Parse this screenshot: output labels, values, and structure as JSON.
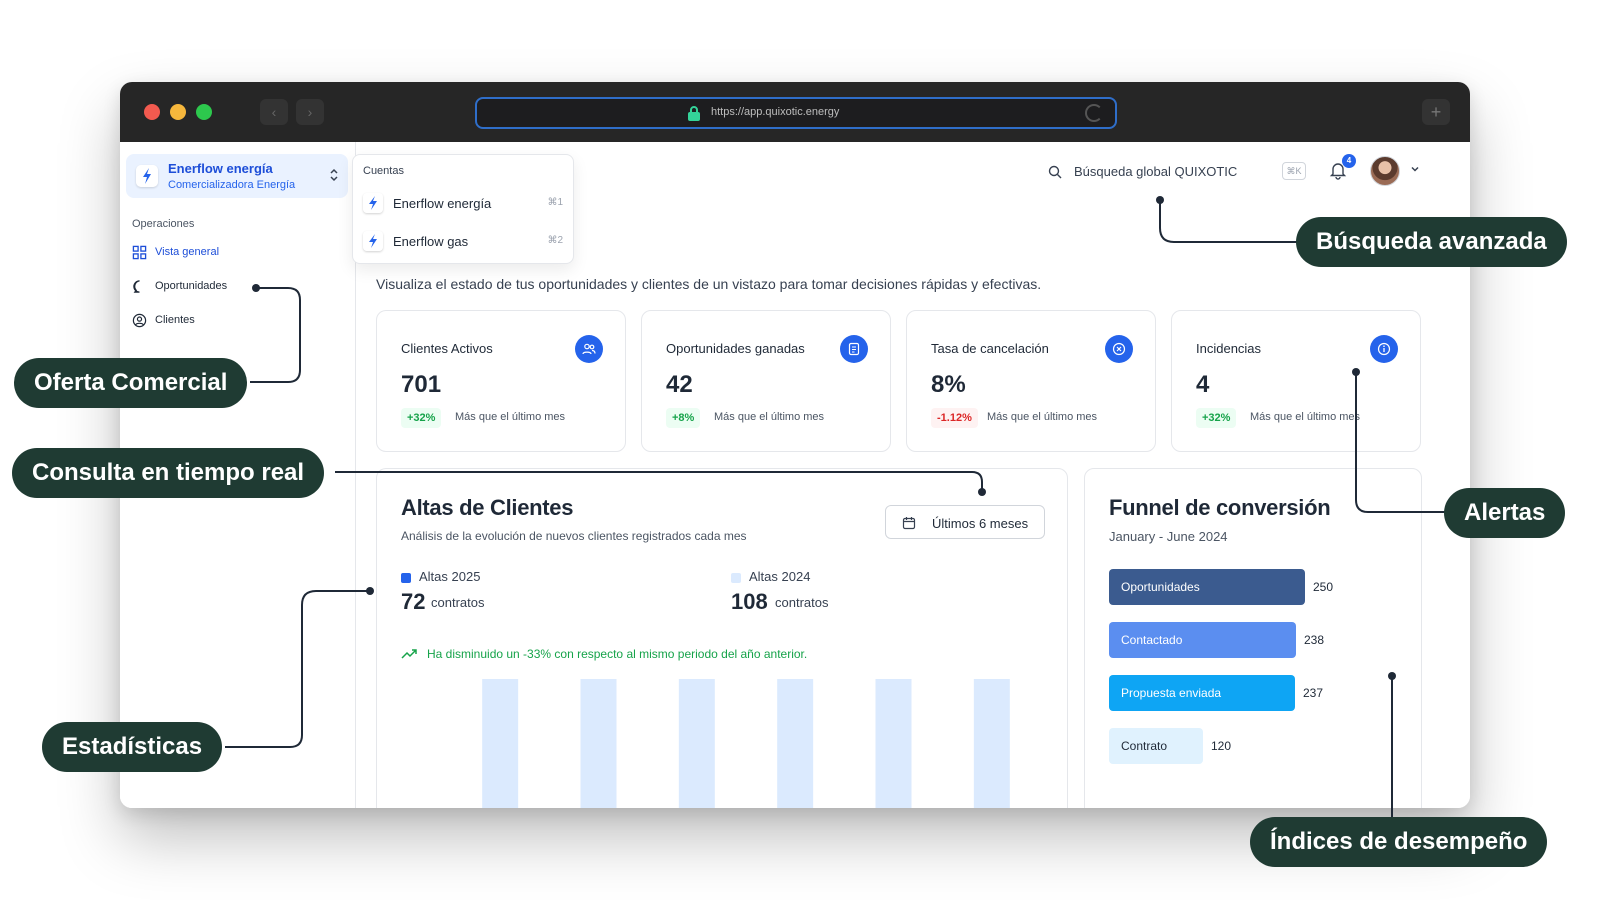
{
  "browser": {
    "url": "https://app.quixotic.energy"
  },
  "org": {
    "name": "Enerflow energía",
    "subtitle": "Comercializadora Energía"
  },
  "sidebar": {
    "section": "Operaciones",
    "items": [
      {
        "label": "Vista general",
        "icon": "grid-icon",
        "active": true
      },
      {
        "label": "Oportunidades",
        "icon": "chat-bubble-icon",
        "active": false
      },
      {
        "label": "Clientes",
        "icon": "user-circle-icon",
        "active": false
      }
    ]
  },
  "accounts": {
    "title": "Cuentas",
    "items": [
      {
        "name": "Enerflow energía",
        "shortcut": "⌘1"
      },
      {
        "name": "Enerflow gas",
        "shortcut": "⌘2"
      }
    ]
  },
  "header": {
    "search_label": "Búsqueda global QUIXOTIC",
    "search_shortcut": "⌘K",
    "notifications": "4"
  },
  "intro": "Visualiza el estado de tus oportunidades y clientes de un vistazo para tomar decisiones rápidas y efectivas.",
  "stats": [
    {
      "title": "Clientes Activos",
      "value": "701",
      "change": "+32%",
      "direction": "up",
      "note": "Más que el último mes",
      "icon": "users-icon"
    },
    {
      "title": "Oportunidades ganadas",
      "value": "42",
      "change": "+8%",
      "direction": "up",
      "note": "Más que el último mes",
      "icon": "document-icon"
    },
    {
      "title": "Tasa de cancelación",
      "value": "8%",
      "change": "-1.12%",
      "direction": "down",
      "note": "Más que el último mes",
      "icon": "close-circle-icon"
    },
    {
      "title": "Incidencias",
      "value": "4",
      "change": "+32%",
      "direction": "up",
      "note": "Más que el último mes",
      "icon": "info-icon"
    }
  ],
  "altas": {
    "title": "Altas de Clientes",
    "subtitle": "Análisis de la evolución de nuevos clientes registrados cada mes",
    "range_label": "Últimos 6 meses",
    "legend": [
      {
        "name": "Altas 2025",
        "value": "72",
        "unit": "contratos",
        "color": "#2563eb"
      },
      {
        "name": "Altas 2024",
        "value": "108",
        "unit": "contratos",
        "color": "#dbeafe"
      }
    ],
    "trend": "Ha disminuido un -33% con respecto al mismo periodo del año anterior."
  },
  "chart_data": {
    "type": "bar",
    "yticks": [
      20,
      15
    ],
    "ylim": [
      0,
      22
    ],
    "bar_color": "#dbeafe",
    "values": [
      19,
      19,
      19,
      19,
      19,
      19
    ]
  },
  "funnel": {
    "title": "Funnel de conversión",
    "subtitle": "January - June 2024",
    "stages": [
      {
        "label": "Oportunidades",
        "value": 250,
        "color": "#3b5b8f",
        "text_color": "#ffffff"
      },
      {
        "label": "Contactado",
        "value": 238,
        "color": "#5b8ef0",
        "text_color": "#ffffff"
      },
      {
        "label": "Propuesta enviada",
        "value": 237,
        "color": "#0ea5f4",
        "text_color": "#ffffff"
      },
      {
        "label": "Contrato",
        "value": 120,
        "color": "#e0f2fe",
        "text_color": "#1f2937"
      }
    ]
  },
  "callouts": {
    "busqueda": "Búsqueda avanzada",
    "oferta": "Oferta Comercial",
    "consulta": "Consulta en tiempo real",
    "alertas": "Alertas",
    "estadisticas": "Estadísticas",
    "indices": "Índices de desempeño"
  },
  "colors": {
    "callout_bg": "#1f3b33",
    "accent": "#2563eb",
    "positive": "#16a34a",
    "negative": "#dc2626"
  }
}
